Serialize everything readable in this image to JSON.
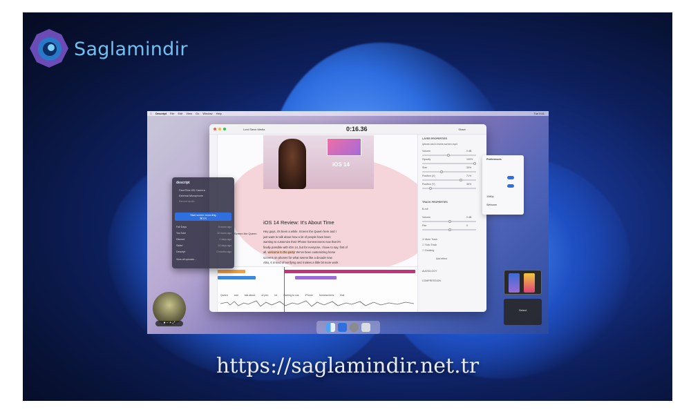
{
  "branding": {
    "logo_text": "Saglamindir",
    "watermark_url": "https://saglamindir.net.tr"
  },
  "menubar": {
    "app": "Descript",
    "items": [
      "File",
      "Edit",
      "View",
      "Go",
      "Window",
      "Help"
    ],
    "clock": "Tue 9:41"
  },
  "editor": {
    "project_name": "Lord Steve Media",
    "timecode": "0:16.36",
    "share_label": "Share",
    "video_overlay_text": "iOS 14",
    "doc_title": "iOS 14 Review: It's About Time",
    "speaker": "Screen the Queen",
    "script_lines": [
      "Hey guys, it's been a while. Screen the Queen here and I",
      "just want to talk about how a lot of people have been",
      "wanting to customize their iPhone homescreens now that it's",
      "finally possible with iOS 14, but for everyone, I have to say, first of",
      "all, welcome to the party! We've been customizing home",
      "screens on phones for what seems like a decade now.",
      "Also, it is kind of terrifying and it takes a little bit more work"
    ],
    "highlight_text": "welcome to the party!",
    "timeline_words": [
      "Queen",
      "and",
      "talk about",
      "of peo",
      "lot",
      "starting to cus",
      "iPhone",
      "homescreens",
      "that"
    ]
  },
  "inspector": {
    "section_layers": "LAYER PROPERTIES",
    "layer_name": "iphone-ios14-home-screen.mp4",
    "rows": [
      {
        "label": "Volume",
        "value": "0 dB"
      },
      {
        "label": "Opacity",
        "value": "100%"
      },
      {
        "label": "Size",
        "value": "35%"
      },
      {
        "label": "Position (X)",
        "value": "71%"
      },
      {
        "label": "Position (Y)",
        "value": "36%"
      }
    ],
    "section_track": "TRACK PROPERTIES",
    "track_name": "B-roll",
    "track_rows": [
      {
        "label": "Volume",
        "value": "0 dB"
      },
      {
        "label": "Pan",
        "value": "0"
      }
    ],
    "checkboxes": [
      {
        "label": "Mute Track",
        "checked": true
      },
      {
        "label": "Solo Track",
        "checked": false
      },
      {
        "label": "Ducking",
        "checked": false
      }
    ],
    "add_effect": "Add effect",
    "collapsed": [
      "AUDIOLOGY",
      "COMPRESSION"
    ]
  },
  "record_popup": {
    "title": "descript",
    "options": [
      "FaceTime HD Camera",
      "External Microphone",
      "Record audio"
    ],
    "start_label": "Start screen recording",
    "start_hotkey": "⌘⇧R",
    "recent": [
      {
        "name": "Fall Days",
        "time": "8 hours ago"
      },
      {
        "name": "YouTube",
        "time": "16 hours ago"
      },
      {
        "name": "Discord",
        "time": "2 days ago"
      },
      {
        "name": "Safari",
        "time": "10 days ago"
      },
      {
        "name": "Descript",
        "time": "2 months ago"
      }
    ],
    "view_all": "View all uploads..."
  },
  "preferences": {
    "title": "Preferences",
    "resolution": "1080p",
    "source": "Webcam"
  },
  "floating": {
    "select_label": "Select"
  },
  "colors": {
    "accent": "#2f6fe0",
    "playhead": "#c23b7e",
    "clip_magenta": "#c2337c",
    "clip_purple": "#9b6bd6",
    "clip_blue": "#3d86e0",
    "clip_orange": "#f2a03d"
  }
}
